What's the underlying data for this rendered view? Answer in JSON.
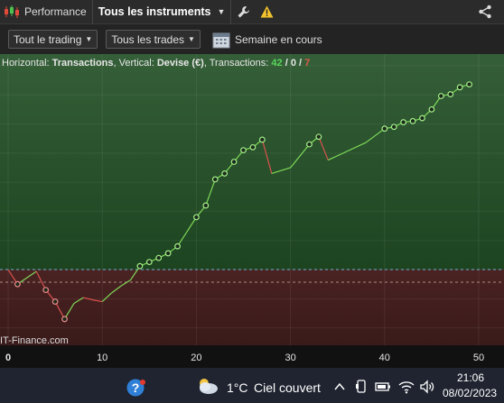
{
  "topbar": {
    "tab_performance": "Performance",
    "tab_instruments": "Tous les instruments"
  },
  "filters": {
    "trading": "Tout le trading",
    "trades": "Tous les trades",
    "period": "Semaine en cours"
  },
  "chart_data": {
    "type": "line",
    "header": {
      "h_label": "Horizontal:",
      "h_value": "Transactions",
      "v_label": "Vertical:",
      "v_value": "Devise (€)",
      "t_label": "Transactions:",
      "wins": "42",
      "sep1": "/",
      "neutral": "0",
      "sep2": "/",
      "losses": "7"
    },
    "watermark": "IT-Finance.com",
    "x_ticks": [
      "0",
      "10",
      "20",
      "30",
      "40",
      "50"
    ],
    "xlim": [
      0,
      51
    ],
    "ylim": [
      -13,
      37
    ],
    "zero_level": 0,
    "points": [
      {
        "x": 0,
        "y": 0
      },
      {
        "x": 1,
        "y": -2.5
      },
      {
        "x": 3,
        "y": -0.3
      },
      {
        "x": 4,
        "y": -3.5
      },
      {
        "x": 5,
        "y": -5.5
      },
      {
        "x": 6,
        "y": -8.5
      },
      {
        "x": 7,
        "y": -5.8
      },
      {
        "x": 8,
        "y": -4.8
      },
      {
        "x": 9,
        "y": -5.2
      },
      {
        "x": 10,
        "y": -5.5
      },
      {
        "x": 11,
        "y": -4
      },
      {
        "x": 12,
        "y": -2.8
      },
      {
        "x": 13,
        "y": -1.8
      },
      {
        "x": 14,
        "y": 0.6
      },
      {
        "x": 15,
        "y": 1.3
      },
      {
        "x": 16,
        "y": 2
      },
      {
        "x": 17,
        "y": 2.8
      },
      {
        "x": 18,
        "y": 4
      },
      {
        "x": 19,
        "y": 6.5
      },
      {
        "x": 20,
        "y": 9
      },
      {
        "x": 21,
        "y": 11
      },
      {
        "x": 22,
        "y": 15.5
      },
      {
        "x": 23,
        "y": 16.5
      },
      {
        "x": 24,
        "y": 18.5
      },
      {
        "x": 25,
        "y": 20.5
      },
      {
        "x": 26,
        "y": 21
      },
      {
        "x": 27,
        "y": 22.3
      },
      {
        "x": 28,
        "y": 16.5
      },
      {
        "x": 30,
        "y": 17.5
      },
      {
        "x": 32,
        "y": 21.5
      },
      {
        "x": 33,
        "y": 22.8
      },
      {
        "x": 34,
        "y": 18.8
      },
      {
        "x": 36,
        "y": 20.3
      },
      {
        "x": 38,
        "y": 21.8
      },
      {
        "x": 40,
        "y": 24.2
      },
      {
        "x": 41,
        "y": 24.5
      },
      {
        "x": 42,
        "y": 25.3
      },
      {
        "x": 43,
        "y": 25.5
      },
      {
        "x": 44,
        "y": 26
      },
      {
        "x": 45,
        "y": 27.5
      },
      {
        "x": 46,
        "y": 29.8
      },
      {
        "x": 47,
        "y": 30.1
      },
      {
        "x": 48,
        "y": 31.3
      },
      {
        "x": 49,
        "y": 31.8
      }
    ],
    "grid": true,
    "colors": {
      "up": "#7ed957",
      "down": "#d9534f",
      "profit_bg": "#2f5a32",
      "loss_bg": "#3d1e1e",
      "zero_line": "#6fb3d2"
    }
  },
  "taskbar": {
    "temperature": "1°C",
    "weather": "Ciel couvert",
    "time": "21:06",
    "date": "08/02/2023"
  }
}
